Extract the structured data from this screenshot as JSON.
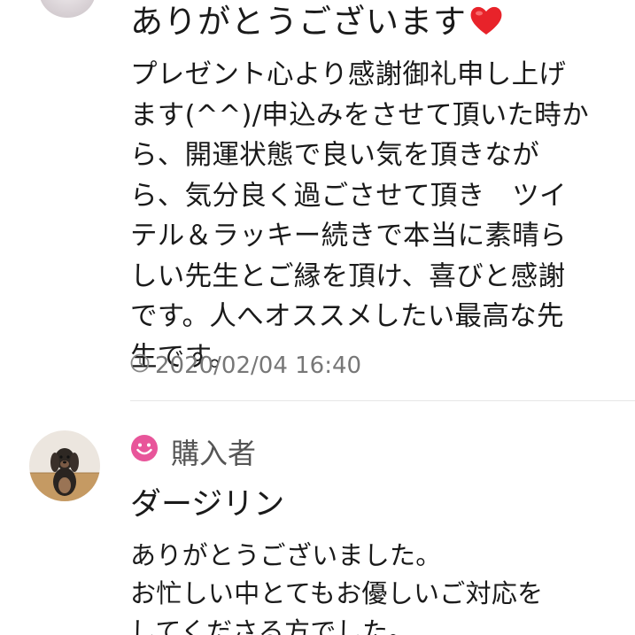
{
  "previous_review": {
    "title": "ありがとうございます",
    "title_icon": "heart-icon",
    "body_lines": [
      "プレゼント心より感謝御礼申し上げ",
      "ます(^^)/申込みをさせて頂いた時か",
      "ら、開運状態で良い気を頂きなが",
      "ら、気分良く過ごさせて頂き　ツイ",
      "テル＆ラッキー続きで本当に素晴ら",
      "しい先生とご縁を頂け、喜びと感謝",
      "です。人へオススメしたい最高な先",
      "生です。"
    ],
    "timestamp": "2020/02/04 16:40",
    "timestamp_icon": "clock-icon"
  },
  "next_review": {
    "role_label": "購入者",
    "role_icon": "smile-icon",
    "author_name": "ダージリン",
    "body_lines": [
      "ありがとうございました。",
      "お忙しい中とてもお優しいご対応を",
      "してくださる方でした。"
    ]
  },
  "colors": {
    "heart": "#e8232a",
    "smile": "#e8559a",
    "meta_text": "#777777",
    "divider": "#e6e6e6"
  }
}
